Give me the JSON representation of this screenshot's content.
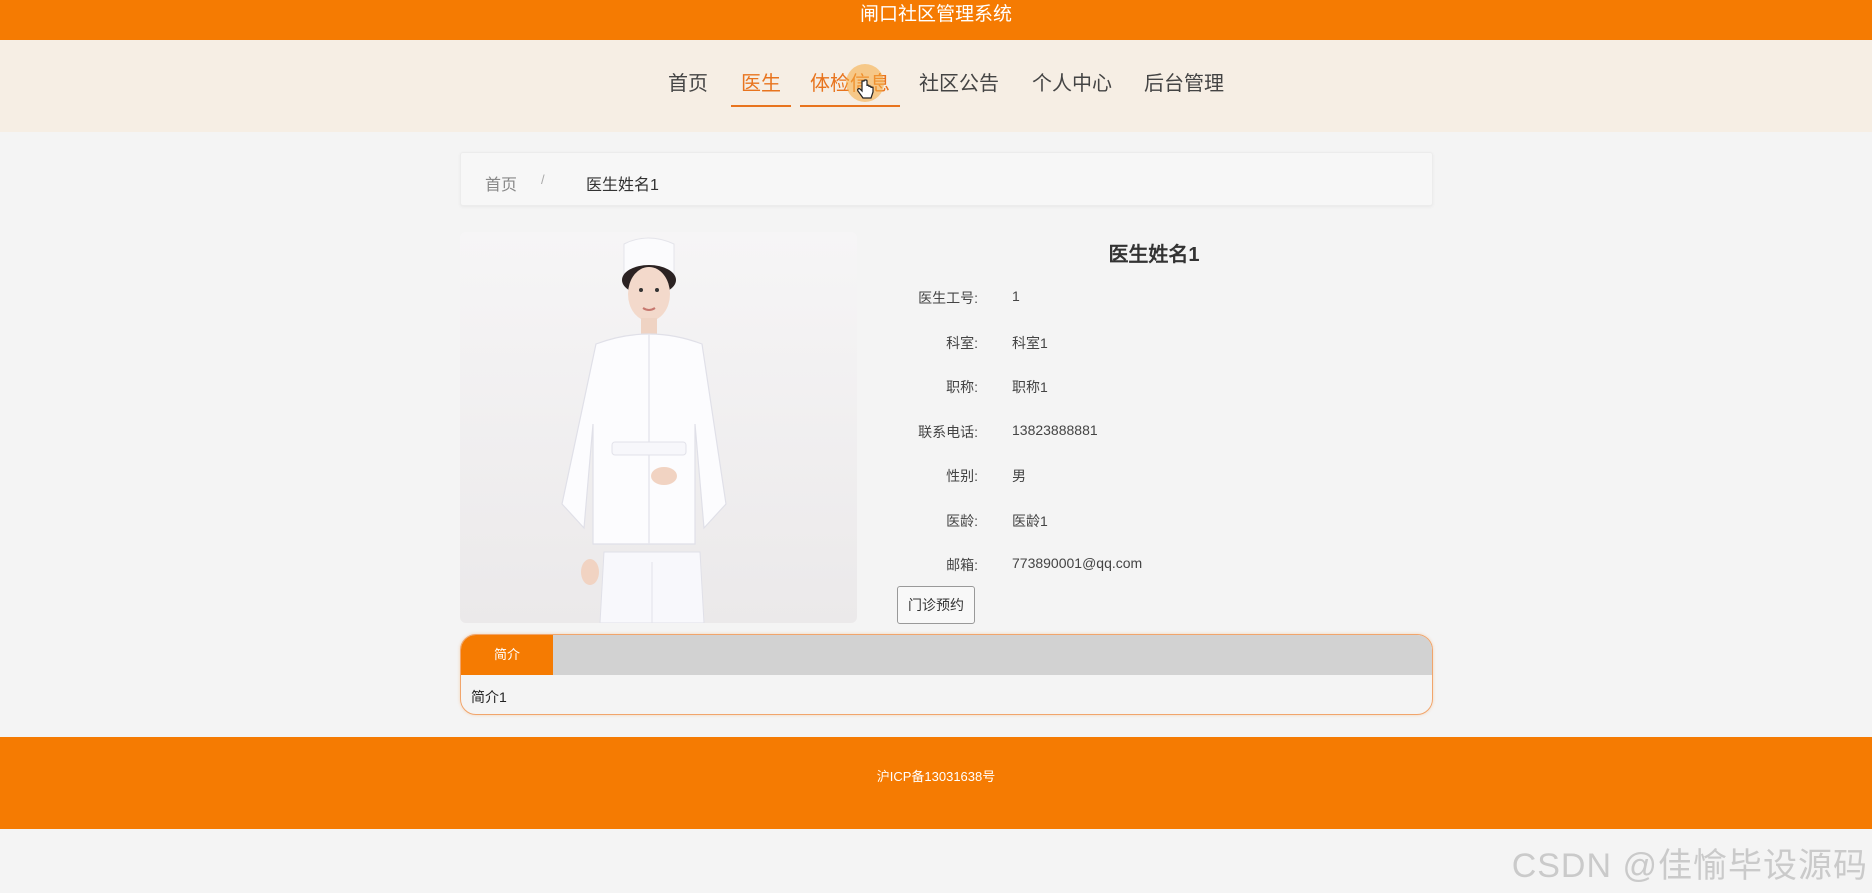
{
  "header": {
    "title": "闸口社区管理系统"
  },
  "nav": {
    "items": [
      {
        "label": "首页"
      },
      {
        "label": "医生"
      },
      {
        "label": "体检信息"
      },
      {
        "label": "社区公告"
      },
      {
        "label": "个人中心"
      },
      {
        "label": "后台管理"
      }
    ],
    "active_index": 1,
    "accent_color": "#e8741e"
  },
  "breadcrumb": {
    "home": "首页",
    "separator": "/",
    "current": "医生姓名1"
  },
  "doctor": {
    "name": "医生姓名1",
    "fields": [
      {
        "label": "医生工号:",
        "value": "1"
      },
      {
        "label": "科室:",
        "value": "科室1"
      },
      {
        "label": "职称:",
        "value": "职称1"
      },
      {
        "label": "联系电话:",
        "value": "13823888881"
      },
      {
        "label": "性别:",
        "value": "男"
      },
      {
        "label": "医龄:",
        "value": "医龄1"
      },
      {
        "label": "邮箱:",
        "value": "773890001@qq.com"
      }
    ],
    "appointment_button": "门诊预约"
  },
  "tabs": {
    "active_label": "简介",
    "content": "简介1"
  },
  "footer": {
    "text": "沪ICP备13031638号"
  },
  "watermark": "CSDN @佳愉毕设源码",
  "colors": {
    "brand": "#f57b02",
    "nav_bg": "#f6eee4"
  }
}
